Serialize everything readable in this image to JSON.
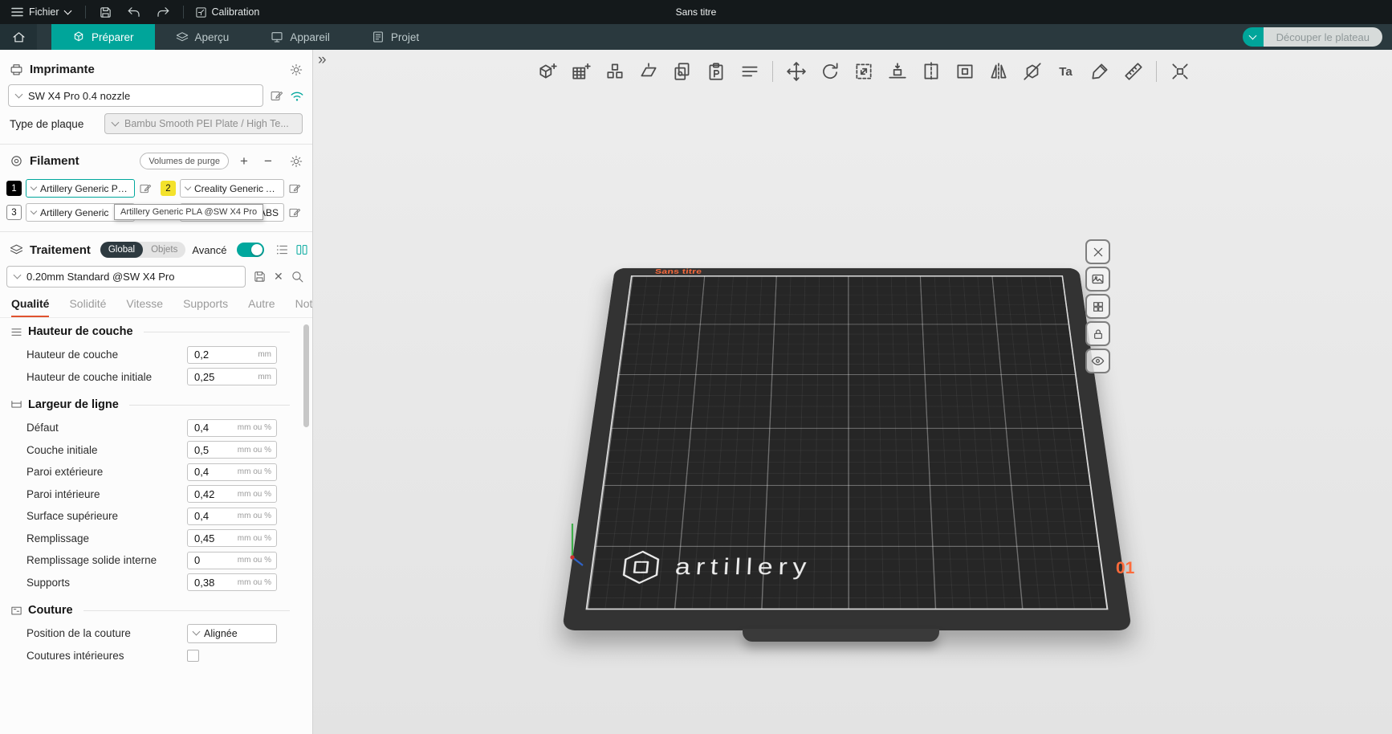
{
  "glyphs": {
    "plus": "+",
    "minus": "−",
    "clear": "✕",
    "collapse": "»",
    "text_tool": "Ta",
    "scroll_up": "⌃"
  },
  "colors": {
    "accent": "#00a59a",
    "orange": "#ff6b3b",
    "tab_underline": "#e0532f",
    "filament2_yellow": "#f4e22c"
  },
  "menubar": {
    "file": "Fichier",
    "calibration": "Calibration",
    "title": "Sans titre"
  },
  "tabbar": {
    "tabs": [
      {
        "label": "Préparer"
      },
      {
        "label": "Aperçu"
      },
      {
        "label": "Appareil"
      },
      {
        "label": "Projet"
      }
    ],
    "slice_button": "Découper le plateau"
  },
  "sidebar": {
    "printer": {
      "title": "Imprimante",
      "model": "SW X4 Pro 0.4 nozzle",
      "plate_type_label": "Type de plaque",
      "plate_type_value": "Bambu Smooth PEI Plate / High Te..."
    },
    "filament": {
      "title": "Filament",
      "purge_button": "Volumes de purge",
      "slot1": {
        "index": "1",
        "name": "Artillery Generic PL..."
      },
      "slot2": {
        "index": "2",
        "name": "Creality Generic ABS"
      },
      "slot3": {
        "index": "3",
        "name": "Artillery Generic"
      },
      "slot4": {
        "name": "ic ABS"
      },
      "tooltip": "Artillery Generic PLA @SW X4 Pro"
    },
    "process": {
      "title": "Traitement",
      "scope_global": "Global",
      "scope_objects": "Objets",
      "advanced_label": "Avancé",
      "preset": "0.20mm Standard @SW X4 Pro",
      "tabs": [
        {
          "label": "Qualité"
        },
        {
          "label": "Solidité"
        },
        {
          "label": "Vitesse"
        },
        {
          "label": "Supports"
        },
        {
          "label": "Autre"
        },
        {
          "label": "Notes"
        }
      ]
    },
    "settings": {
      "sections": [
        {
          "title": "Hauteur de couche",
          "rows": [
            {
              "label": "Hauteur de couche",
              "value": "0,2",
              "unit": "mm"
            },
            {
              "label": "Hauteur de couche initiale",
              "value": "0,25",
              "unit": "mm"
            }
          ]
        },
        {
          "title": "Largeur de ligne",
          "rows": [
            {
              "label": "Défaut",
              "value": "0,4",
              "unit": "mm ou %"
            },
            {
              "label": "Couche initiale",
              "value": "0,5",
              "unit": "mm ou %"
            },
            {
              "label": "Paroi extérieure",
              "value": "0,4",
              "unit": "mm ou %"
            },
            {
              "label": "Paroi intérieure",
              "value": "0,42",
              "unit": "mm ou %"
            },
            {
              "label": "Surface supérieure",
              "value": "0,4",
              "unit": "mm ou %"
            },
            {
              "label": "Remplissage",
              "value": "0,45",
              "unit": "mm ou %"
            },
            {
              "label": "Remplissage solide interne",
              "value": "0",
              "unit": "mm ou %"
            },
            {
              "label": "Supports",
              "value": "0,38",
              "unit": "mm ou %"
            }
          ]
        },
        {
          "title": "Couture",
          "rows": [
            {
              "label": "Position de la couture",
              "value": "Alignée"
            },
            {
              "label": "Coutures intérieures"
            }
          ]
        }
      ]
    }
  },
  "viewport": {
    "plate_title": "Sans titre",
    "logo_text": "artillery",
    "plate_number": "01"
  }
}
